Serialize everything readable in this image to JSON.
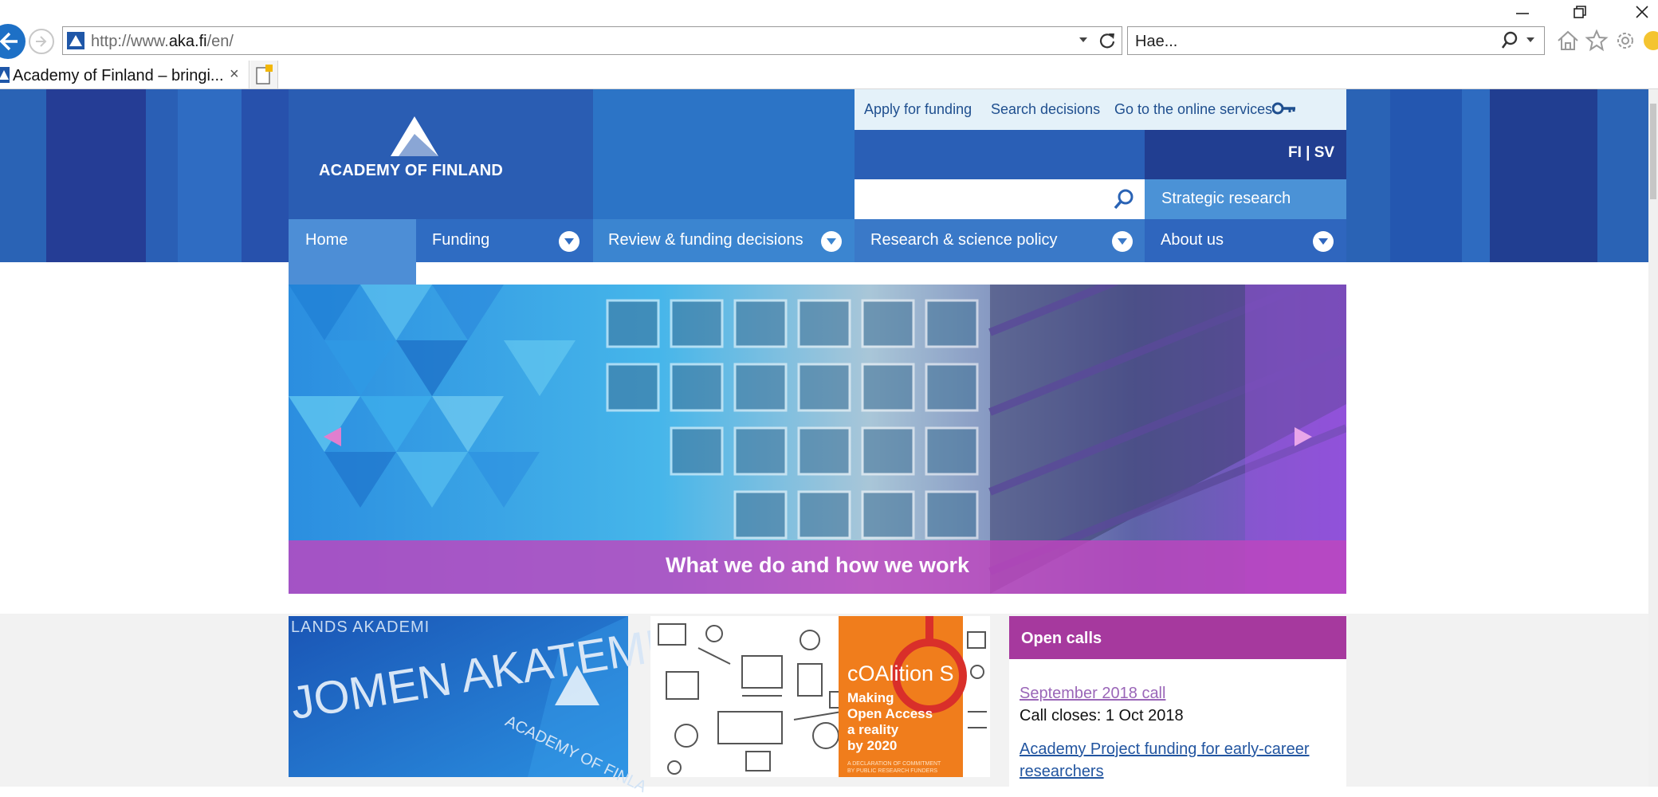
{
  "browser": {
    "address": {
      "prefix": "http://www.",
      "domain": "aka.fi",
      "suffix": "/en/"
    },
    "search_placeholder": "Hae...",
    "tab_title": "Academy of Finland – bringi...",
    "tab_close": "×"
  },
  "site": {
    "logo_text": "ACADEMY OF FINLAND",
    "top_links": [
      "Apply for funding",
      "Search decisions",
      "Go to the online services"
    ],
    "language": "FI | SV",
    "strategic": "Strategic research",
    "nav": [
      {
        "label": "Home"
      },
      {
        "label": "Funding"
      },
      {
        "label": "Review & funding decisions"
      },
      {
        "label": "Research & science policy"
      },
      {
        "label": "About us"
      }
    ],
    "hero_caption": "What we do and how we work",
    "card1_words": {
      "top": "LANDS AKADEMI",
      "main": "JOMEN AKATEMIA",
      "diag": "ACADEMY OF FINLA"
    },
    "card2": {
      "brand": "cOAlition S",
      "lines": [
        "Making",
        "Open Access",
        "a reality",
        "by 2020"
      ],
      "fine_print": [
        "A DECLARATION OF COMMITMENT",
        "BY PUBLIC RESEARCH FUNDERS"
      ]
    },
    "open_calls": {
      "title": "Open calls",
      "link1": "September 2018 call",
      "closes": "Call closes: 1 Oct 2018",
      "link2_line1": "Academy Project funding for early-career",
      "link2_line2": "researchers"
    }
  },
  "colors": {
    "brand_blue": "#2a63b5",
    "dark_blue": "#213e91",
    "purple": "#a6399e",
    "orange": "#f07d1c"
  }
}
